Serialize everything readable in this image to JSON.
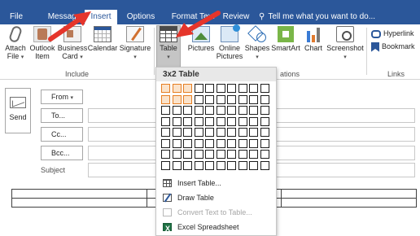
{
  "tabs": [
    {
      "label": "File"
    },
    {
      "label": "Message"
    },
    {
      "label": "Insert"
    },
    {
      "label": "Options"
    },
    {
      "label": "Format Text"
    },
    {
      "label": "Review"
    }
  ],
  "tell_me": "Tell me what you want to do...",
  "ribbon": {
    "include": {
      "attach_file": "Attach\nFile",
      "outlook_item": "Outlook\nItem",
      "business_card": "Business\nCard",
      "calendar": "Calendar",
      "signature": "Signature",
      "group_label": "Include"
    },
    "illustrations": {
      "table": "Table",
      "pictures": "Pictures",
      "online_pictures": "Online\nPictures",
      "shapes": "Shapes",
      "smartart": "SmartArt",
      "chart": "Chart",
      "screenshot": "Screenshot",
      "group_label_partial": "ations"
    },
    "links": {
      "hyperlink": "Hyperlink",
      "bookmark": "Bookmark",
      "group_label": "Links"
    }
  },
  "compose": {
    "send": "Send",
    "from": "From",
    "to": "To...",
    "cc": "Cc...",
    "bcc": "Bcc...",
    "subject": "Subject"
  },
  "table_menu": {
    "header": "3x2 Table",
    "highlight": {
      "cols": 3,
      "rows": 2
    },
    "grid": {
      "cols": 10,
      "rows": 8
    },
    "items": [
      {
        "label": "Insert Table...",
        "enabled": true
      },
      {
        "label": "Draw Table",
        "enabled": true
      },
      {
        "label": "Convert Text to Table...",
        "enabled": false
      },
      {
        "label": "Excel Spreadsheet",
        "enabled": true
      }
    ]
  },
  "doc_table": {
    "rows": 2,
    "cols": 3
  },
  "colors": {
    "ribbon_blue": "#2b579a",
    "highlight_orange": "#e67e22",
    "arrow_red": "#e5352b"
  },
  "icons": [
    "lightbulb-icon",
    "paperclip-icon",
    "outlook-item-icon",
    "business-card-icon",
    "calendar-icon",
    "signature-icon",
    "table-icon",
    "pictures-icon",
    "online-pictures-icon",
    "shapes-icon",
    "smartart-icon",
    "chart-icon",
    "screenshot-icon",
    "hyperlink-icon",
    "bookmark-icon",
    "send-icon"
  ]
}
